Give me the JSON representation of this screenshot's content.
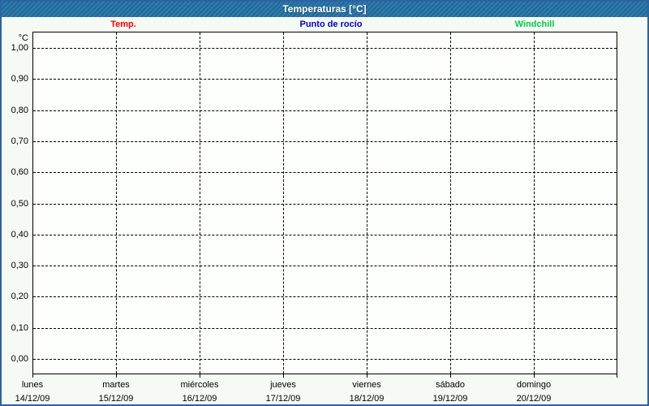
{
  "window": {
    "title": "Temperaturas [°C]"
  },
  "legend": {
    "items": [
      {
        "label": "Temp.",
        "color": "#ff0000"
      },
      {
        "label": "Punto de rocío",
        "color": "#0000cc"
      },
      {
        "label": "Windchill",
        "color": "#00cc44"
      }
    ]
  },
  "y_axis": {
    "unit": "°C",
    "ticks": [
      "1,00",
      "0,90",
      "0,80",
      "0,70",
      "0,60",
      "0,50",
      "0,40",
      "0,30",
      "0,20",
      "0,10",
      "0,00"
    ]
  },
  "x_axis": {
    "days": [
      {
        "name": "lunes",
        "date": "14/12/09"
      },
      {
        "name": "martes",
        "date": "15/12/09"
      },
      {
        "name": "miércoles",
        "date": "16/12/09"
      },
      {
        "name": "jueves",
        "date": "17/12/09"
      },
      {
        "name": "viernes",
        "date": "18/12/09"
      },
      {
        "name": "sábado",
        "date": "19/12/09"
      },
      {
        "name": "domingo",
        "date": "20/12/09"
      }
    ]
  },
  "chart_data": {
    "type": "line",
    "title": "Temperaturas [°C]",
    "ylabel": "°C",
    "ylim": [
      0.0,
      1.0
    ],
    "y_tick_step": 0.1,
    "grid": true,
    "legend_position": "top",
    "x_categories": [
      "lunes 14/12/09",
      "martes 15/12/09",
      "miércoles 16/12/09",
      "jueves 17/12/09",
      "viernes 18/12/09",
      "sábado 19/12/09",
      "domingo 20/12/09"
    ],
    "series": [
      {
        "name": "Temp.",
        "color": "#ff0000",
        "values": []
      },
      {
        "name": "Punto de rocío",
        "color": "#0000cc",
        "values": []
      },
      {
        "name": "Windchill",
        "color": "#00cc44",
        "values": []
      }
    ]
  },
  "colors": {
    "titlebar": "#2270a4",
    "window_border": "#2d62a2",
    "background": "#f5faf5",
    "grid": "#000000"
  }
}
